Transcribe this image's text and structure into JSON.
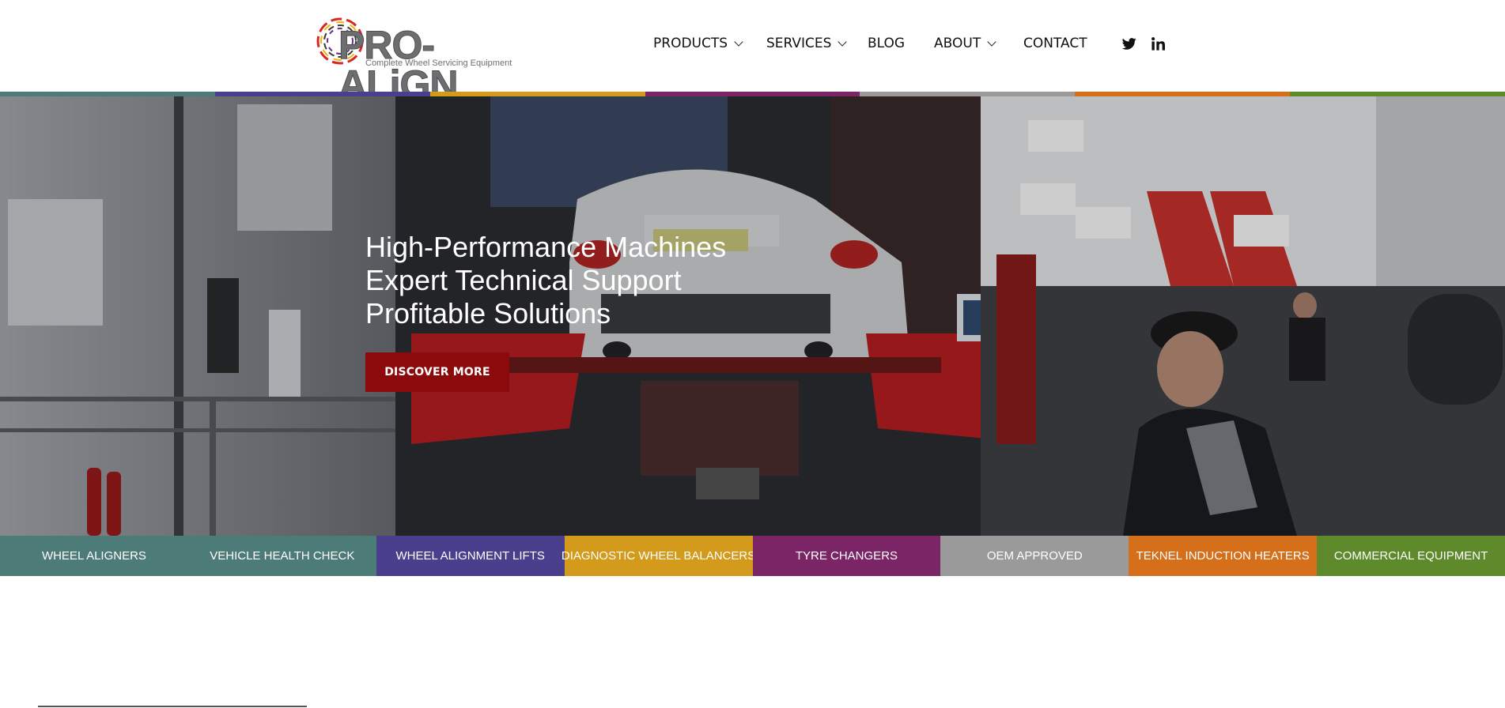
{
  "header": {
    "logo": {
      "name": "PRO-ALiGN",
      "tagline": "Complete Wheel Servicing Equipment"
    },
    "nav": [
      {
        "label": "PRODUCTS",
        "has_dropdown": true
      },
      {
        "label": "SERVICES",
        "has_dropdown": true
      },
      {
        "label": "BLOG",
        "has_dropdown": false
      },
      {
        "label": "ABOUT",
        "has_dropdown": true
      },
      {
        "label": "CONTACT",
        "has_dropdown": false
      }
    ],
    "social": [
      {
        "icon": "twitter-icon"
      },
      {
        "icon": "linkedin-icon"
      }
    ]
  },
  "strip_colors": [
    "#4d7b78",
    "#4a3f8c",
    "#d39a1c",
    "#7b2466",
    "#9a9a9a",
    "#d56f1a",
    "#5e8a2c"
  ],
  "hero": {
    "headlines": [
      "High-Performance Machines",
      "Expert Technical Support",
      "Profitable Solutions"
    ],
    "cta_label": "DISCOVER MORE",
    "cta_color": "#8b0a0c"
  },
  "categories": [
    {
      "label": "WHEEL ALIGNERS",
      "color": "#4c7b78"
    },
    {
      "label": "VEHICLE HEALTH CHECK",
      "color": "#4d7b78"
    },
    {
      "label": "WHEEL ALIGNMENT LIFTS",
      "color": "#4a3f8c"
    },
    {
      "label": "DIAGNOSTIC WHEEL BALANCERS",
      "color": "#d39a1c"
    },
    {
      "label": "TYRE CHANGERS",
      "color": "#7b2466"
    },
    {
      "label": "OEM APPROVED",
      "color": "#9a9a9a"
    },
    {
      "label": "TEKNEL INDUCTION HEATERS",
      "color": "#d56f1a"
    },
    {
      "label": "COMMERCIAL EQUIPMENT",
      "color": "#5e8a2c"
    }
  ]
}
